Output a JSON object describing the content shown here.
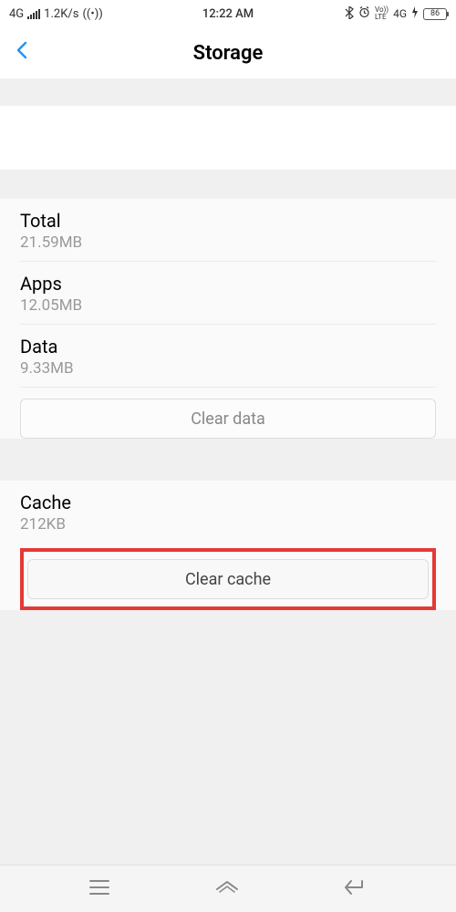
{
  "status": {
    "network": "4G",
    "speed": "1.2K/s",
    "time": "12:22 AM",
    "volte": "Vo))",
    "lte": "LTE",
    "net2": "4G",
    "battery": "86"
  },
  "header": {
    "title": "Storage"
  },
  "storage": {
    "total": {
      "label": "Total",
      "value": "21.59MB"
    },
    "apps": {
      "label": "Apps",
      "value": "12.05MB"
    },
    "data": {
      "label": "Data",
      "value": "9.33MB"
    },
    "clear_data_label": "Clear data"
  },
  "cache": {
    "label": "Cache",
    "value": "212KB",
    "clear_cache_label": "Clear cache"
  }
}
